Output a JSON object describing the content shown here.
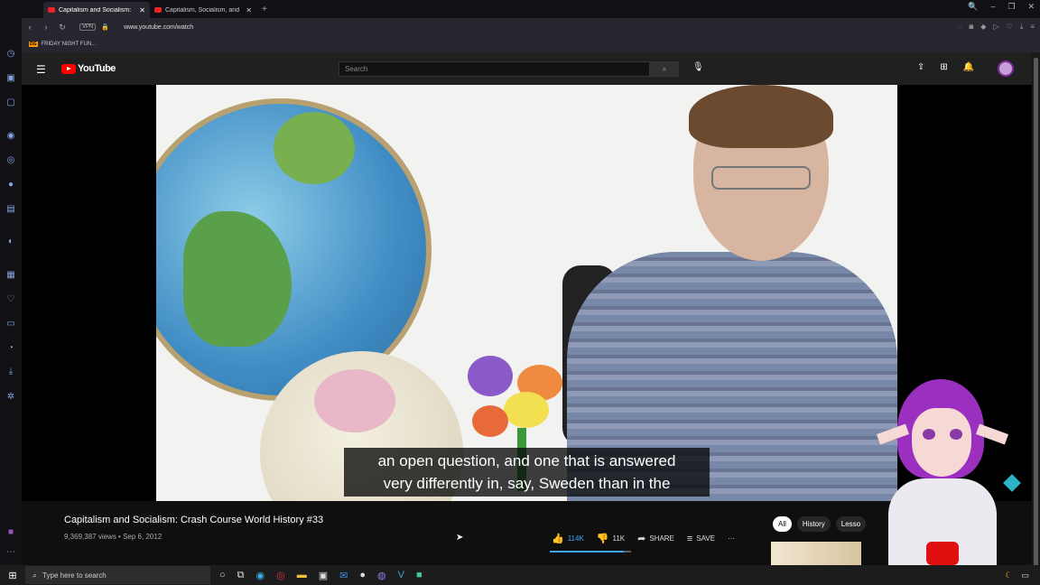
{
  "browser": {
    "tabs": [
      {
        "title": "Capitalism and Socialism:",
        "active": true
      },
      {
        "title": "Capitalism, Socialism, and",
        "active": false
      }
    ],
    "new_tab": "+",
    "window_controls": [
      "🔍",
      "–",
      "❐",
      "✕"
    ],
    "nav": {
      "back": "‹",
      "forward": "›",
      "reload": "↻"
    },
    "vpn_label": "VPN",
    "url": "www.youtube.com/watch",
    "bookmark": {
      "icon_text": "DG",
      "label": "FRIDAY NIGHT FUN..."
    }
  },
  "youtube": {
    "logo_text": "YouTube",
    "search_placeholder": "Search",
    "search_button_icon": "⌕",
    "mic_icon": "🎙"
  },
  "video": {
    "caption_line1": "an open question, and one that is answered",
    "caption_line2": "very differently in, say, Sweden than in the",
    "title": "Capitalism and Socialism: Crash Course World History #33",
    "views": "9,369,387 views",
    "date": "Sep 6, 2012",
    "meta_separator": " • ",
    "likes": "114K",
    "dislikes": "11K",
    "like_ratio": 0.91,
    "share_label": "SHARE",
    "save_label": "SAVE",
    "more_label": "···"
  },
  "chips": [
    "All",
    "History",
    "Lesso"
  ],
  "taskbar": {
    "search_placeholder": "Type here to search"
  },
  "colors": {
    "accent": "#3ea6ff",
    "brand_red": "#ff0000"
  }
}
